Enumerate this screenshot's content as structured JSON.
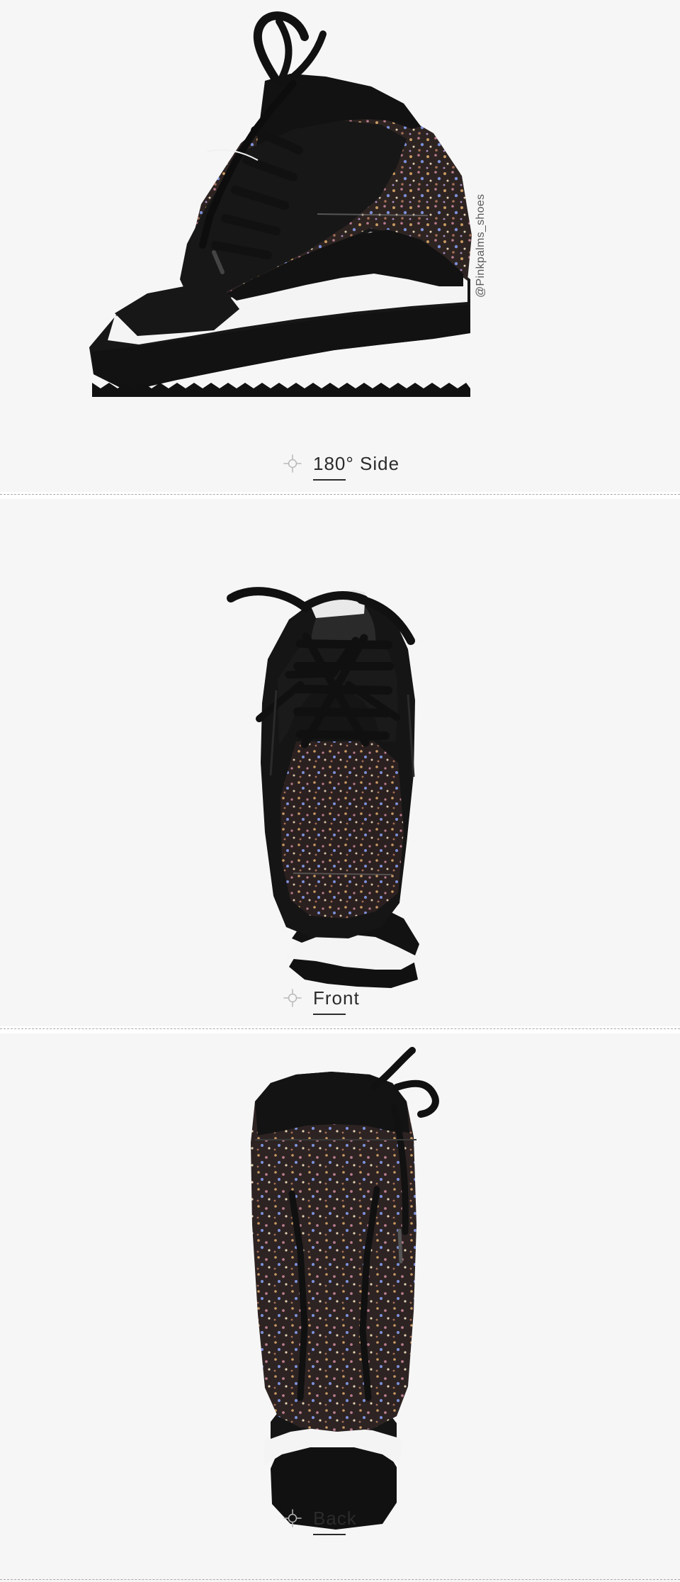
{
  "colors": {
    "background": "#f6f6f6",
    "black_suede": "#121212",
    "white_stripe": "#f4f4f4",
    "glitter_dark": "#2b2020",
    "glitter_gold": "#c89a62",
    "glitter_pink": "#b97c8d",
    "glitter_blue": "#7c8fd8"
  },
  "watermark": {
    "text": "@Pinkpalms_shoes"
  },
  "sections": [
    {
      "caption": "180° Side",
      "icon": "crosshair-icon"
    },
    {
      "caption": "Front",
      "icon": "crosshair-icon"
    },
    {
      "caption": "Back",
      "icon": "crosshair-icon"
    }
  ]
}
